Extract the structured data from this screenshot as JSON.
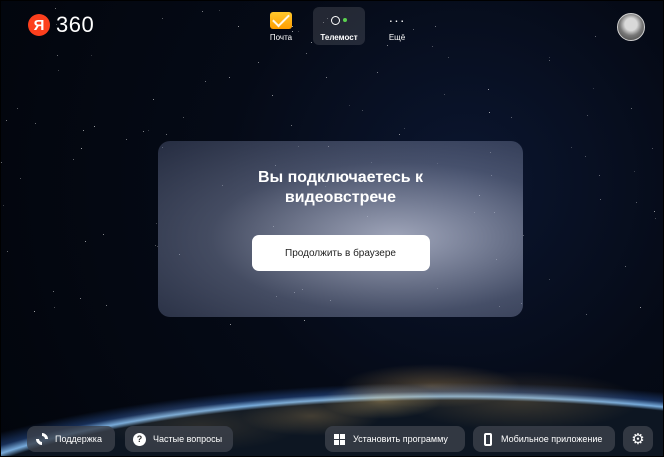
{
  "header": {
    "logo_letter": "Я",
    "logo_text": "360",
    "nav": [
      {
        "label": "Почта",
        "icon": "mail-icon",
        "active": false
      },
      {
        "label": "Телемост",
        "icon": "telemost-icon",
        "active": true
      },
      {
        "label": "Ещё",
        "icon": "more-icon",
        "active": false
      }
    ],
    "avatar": "user-avatar-icon"
  },
  "card": {
    "title": "Вы подключаетесь к видеовстрече",
    "button_label": "Продолжить в браузере"
  },
  "footer": {
    "support_label": "Поддержка",
    "faq_label": "Частые вопросы",
    "install_label": "Установить программу",
    "mobile_label": "Мобильное приложение",
    "settings_icon": "gear-icon"
  },
  "colors": {
    "brand_red": "#fc3f1d",
    "mail_yellow": "#ffc82c",
    "telemost_green": "#5bd24f"
  }
}
